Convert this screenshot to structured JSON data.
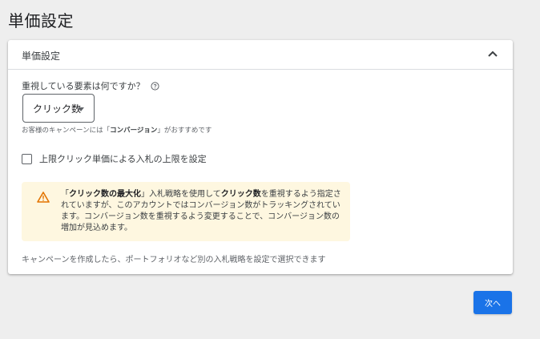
{
  "page": {
    "title": "単価設定"
  },
  "card": {
    "title": "単価設定",
    "collapse_icon": "chevron-up-icon",
    "question": {
      "label": "重視している要素は何ですか？",
      "help_icon": "help-circle-icon"
    },
    "focus_select": {
      "selected": "クリック数",
      "icon": "dropdown-arrow-icon"
    },
    "recommendation": {
      "prefix": "お客様のキャンペーンには「",
      "highlight": "コンバージョン",
      "suffix": "」がおすすめです"
    },
    "max_cpc": {
      "label": "上限クリック単価による入札の上限を設定",
      "checked": false
    },
    "warning": {
      "icon": "warning-triangle-icon",
      "part1": "「",
      "bold1": "クリック数の最大化",
      "part2": "」入札戦略を使用して",
      "bold2": "クリック数",
      "part3": "を重視するよう指定されていますが、このアカウントではコンバージョン数がトラッキングされています。コンバージョン数を重視するよう変更することで、コンバージョン数の増加が見込めます。",
      "background_color": "#fef7e0",
      "icon_color": "#e37400"
    },
    "footer_note": "キャンペーンを作成したら、ポートフォリオなど別の入札戦略を設定で選択できます"
  },
  "actions": {
    "next_label": "次へ",
    "next_color": "#1a73e8"
  }
}
